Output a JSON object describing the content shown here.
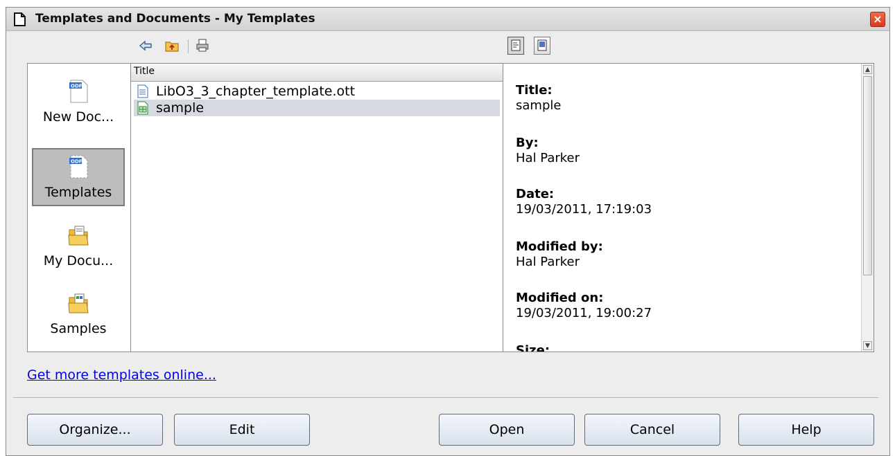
{
  "window": {
    "title": "Templates and Documents - My Templates",
    "close_label": "×"
  },
  "toolbar": {
    "back_icon": "back-arrow-icon",
    "up_folder_icon": "folder-up-icon",
    "print_icon": "printer-icon",
    "view_document_properties_icon": "document-properties-icon",
    "view_preview_icon": "preview-icon"
  },
  "sidebar": {
    "items": [
      {
        "label": "New Doc...",
        "icon": "odf-document-icon",
        "selected": false
      },
      {
        "label": "Templates",
        "icon": "odf-template-icon",
        "selected": true
      },
      {
        "label": "My Docu...",
        "icon": "folder-documents-icon",
        "selected": false
      },
      {
        "label": "Samples",
        "icon": "folder-samples-icon",
        "selected": false
      }
    ]
  },
  "file_list": {
    "header": "Title",
    "rows": [
      {
        "name": "LibO3_3_chapter_template.ott",
        "icon": "text-template-icon",
        "selected": false
      },
      {
        "name": "sample",
        "icon": "spreadsheet-template-icon",
        "selected": true
      }
    ]
  },
  "info": {
    "title_label": "Title:",
    "title_value": "sample",
    "by_label": "By:",
    "by_value": "Hal Parker",
    "date_label": "Date:",
    "date_value": "19/03/2011, 17:19:03",
    "modified_by_label": "Modified by:",
    "modified_by_value": "Hal Parker",
    "modified_on_label": "Modified on:",
    "modified_on_value": "19/03/2011, 19:00:27",
    "size_label": "Size:"
  },
  "link": {
    "label": "Get more templates online..."
  },
  "buttons": {
    "organize": "Organize...",
    "edit": "Edit",
    "open": "Open",
    "cancel": "Cancel",
    "help": "Help"
  },
  "colors": {
    "selection": "#d7d9e1",
    "link": "#0000ee",
    "close_button": "#e04a2c"
  }
}
